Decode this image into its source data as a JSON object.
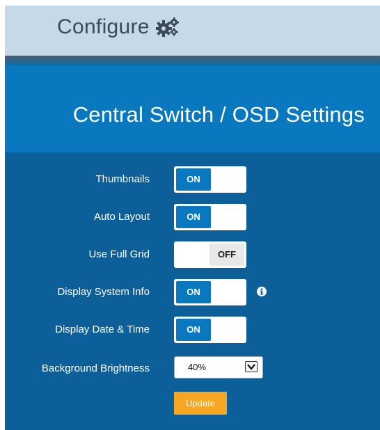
{
  "header": {
    "title": "Configure",
    "icon": "gears-icon"
  },
  "panel": {
    "title": "Central Switch / OSD Settings"
  },
  "settings": [
    {
      "label": "Thumbnails",
      "state": "ON"
    },
    {
      "label": "Auto Layout",
      "state": "ON"
    },
    {
      "label": "Use Full Grid",
      "state": "OFF"
    },
    {
      "label": "Display System Info",
      "state": "ON",
      "info_icon": "info-icon"
    },
    {
      "label": "Display Date & Time",
      "state": "ON"
    }
  ],
  "brightness": {
    "label": "Background Brightness",
    "value": "40%"
  },
  "update_label": "Update",
  "colors": {
    "header_bg": "#c5d9e8",
    "panel_title_bg": "#0a78be",
    "panel_body_bg": "#0d5f9a",
    "toggle_on": "#0a78be",
    "update_button": "#f6a623"
  }
}
